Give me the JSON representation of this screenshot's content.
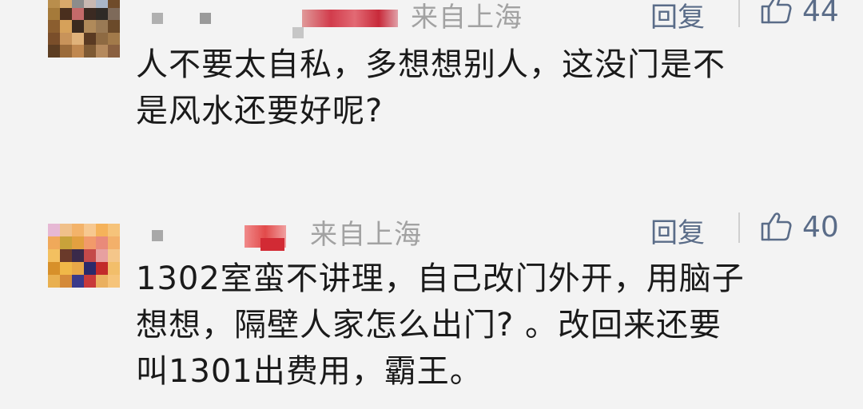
{
  "comments": [
    {
      "location": "来自上海",
      "reply_label": "回复",
      "like_count": "44",
      "text_lines": [
        "人不要太自私，多想想别人，这没门是不",
        "是风水还要好呢?"
      ],
      "avatar_colors": [
        "#b98e4c",
        "#d9a86b",
        "#8c8c8c",
        "#c9b8b2",
        "#a9b6c9",
        "#6f4b2a",
        "#a57a3a",
        "#4a2f1e",
        "#c46a6a",
        "#3b2a22",
        "#2f2a26",
        "#7e6a5a",
        "#8b5e2f",
        "#d6a15a",
        "#3a2a1f",
        "#b08a5a",
        "#9a7a55",
        "#6b4a2a",
        "#7a4e2a",
        "#c8935a",
        "#e0b27a",
        "#5a3a22",
        "#8e6a42",
        "#a27a4a",
        "#5c3d22",
        "#9b6b3a",
        "#c08850",
        "#7e5a34",
        "#b58a5e",
        "#8a6040"
      ]
    },
    {
      "location": "来自上海",
      "reply_label": "回复",
      "like_count": "40",
      "text_lines": [
        "1302室蛮不讲理，自己改门外开，用脑子",
        "想想，隔壁人家怎么出门? 。改回来还要",
        "叫1301出费用，霸王。"
      ],
      "avatar_colors": [
        "#e6b8d4",
        "#f0c08a",
        "#f3b36a",
        "#f7c890",
        "#f5b25a",
        "#f6c37a",
        "#f0a95a",
        "#c8a23a",
        "#e3a040",
        "#f29a6a",
        "#e98a7a",
        "#f3b06a",
        "#f3c060",
        "#6a3a2a",
        "#3a2a4a",
        "#c44a4a",
        "#e7a0a0",
        "#f4c68a",
        "#d7902a",
        "#f0b848",
        "#e8a848",
        "#2a2a6a",
        "#c22a2a",
        "#f2be6a",
        "#e9b050",
        "#d48a3a",
        "#3a3a8a",
        "#c83a3a",
        "#eab060",
        "#f6c47a"
      ]
    }
  ],
  "colors": {
    "background": "#f3f3f3",
    "text": "#1a1a1a",
    "meta_gray": "#a2a2a2",
    "accent_blue": "#5a6c88"
  }
}
